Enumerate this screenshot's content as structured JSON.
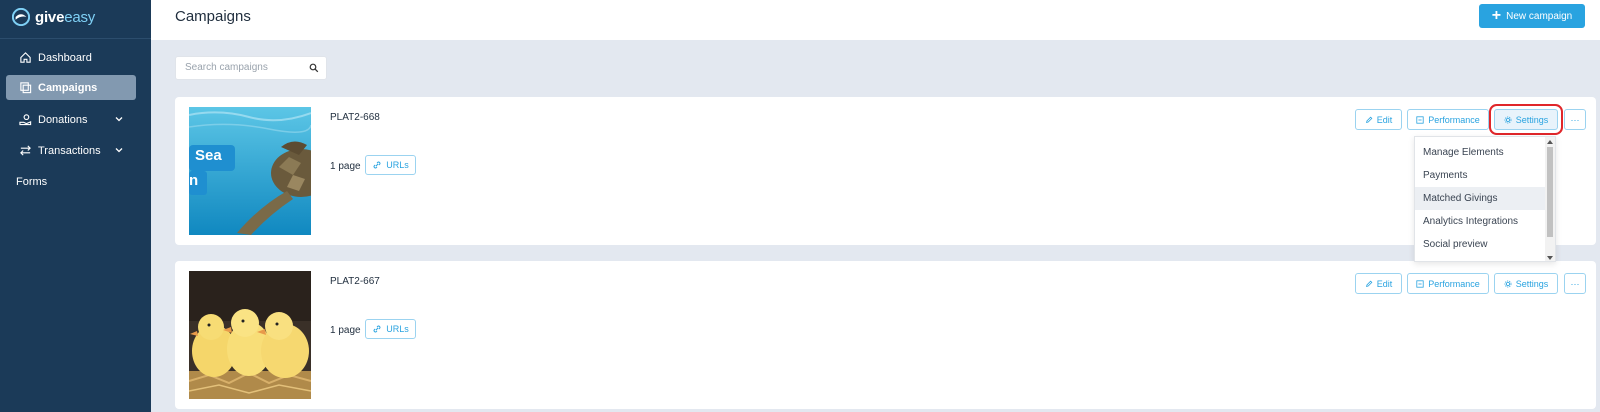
{
  "app": {
    "logo_part1": "give",
    "logo_part2": "easy"
  },
  "sidebar": {
    "items": [
      {
        "label": "Dashboard",
        "icon": "home-icon",
        "active": false
      },
      {
        "label": "Campaigns",
        "icon": "campaigns-icon",
        "active": true
      },
      {
        "label": "Donations",
        "icon": "donations-icon",
        "expandable": true
      },
      {
        "label": "Transactions",
        "icon": "transactions-icon",
        "expandable": true
      },
      {
        "label": "Forms"
      }
    ]
  },
  "header": {
    "title": "Campaigns",
    "new_campaign_label": "New campaign"
  },
  "search": {
    "placeholder": "Search campaigns",
    "value": ""
  },
  "campaigns": [
    {
      "name": "PLAT2-668",
      "pages": "1 page",
      "image_text": [
        "Sea",
        "n"
      ],
      "image_subject": "sea turtle underwater"
    },
    {
      "name": "PLAT2-667",
      "pages": "1 page",
      "image_subject": "yellow ducklings"
    }
  ],
  "actions": {
    "urls": "URLs",
    "edit": "Edit",
    "performance": "Performance",
    "settings": "Settings",
    "more": "···"
  },
  "settings_menu": {
    "items": [
      "Manage Elements",
      "Payments",
      "Matched Givings",
      "Analytics Integrations",
      "Social preview"
    ],
    "hovered": "Matched Givings"
  },
  "colors": {
    "sidebar": "#1b3a58",
    "accent": "#29a3e0",
    "highlight": "#e0262a"
  }
}
